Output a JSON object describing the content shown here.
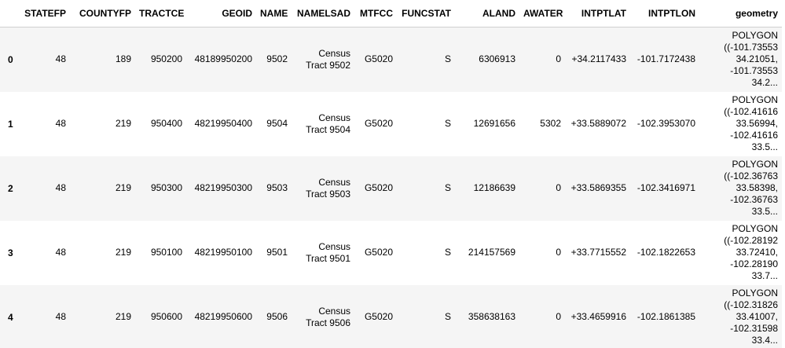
{
  "table": {
    "index_header": "",
    "columns": [
      "STATEFP",
      "COUNTYFP",
      "TRACTCE",
      "GEOID",
      "NAME",
      "NAMELSAD",
      "MTFCC",
      "FUNCSTAT",
      "ALAND",
      "AWATER",
      "INTPTLAT",
      "INTPTLON",
      "geometry"
    ],
    "rows": [
      {
        "index": "0",
        "cells": [
          "48",
          "189",
          "950200",
          "48189950200",
          "9502",
          "Census Tract 9502",
          "G5020",
          "S",
          "6306913",
          "0",
          "+34.2117433",
          "-101.7172438",
          "POLYGON ((-101.73553 34.21051, -101.73553 34.2..."
        ]
      },
      {
        "index": "1",
        "cells": [
          "48",
          "219",
          "950400",
          "48219950400",
          "9504",
          "Census Tract 9504",
          "G5020",
          "S",
          "12691656",
          "5302",
          "+33.5889072",
          "-102.3953070",
          "POLYGON ((-102.41616 33.56994, -102.41616 33.5..."
        ]
      },
      {
        "index": "2",
        "cells": [
          "48",
          "219",
          "950300",
          "48219950300",
          "9503",
          "Census Tract 9503",
          "G5020",
          "S",
          "12186639",
          "0",
          "+33.5869355",
          "-102.3416971",
          "POLYGON ((-102.36763 33.58398, -102.36763 33.5..."
        ]
      },
      {
        "index": "3",
        "cells": [
          "48",
          "219",
          "950100",
          "48219950100",
          "9501",
          "Census Tract 9501",
          "G5020",
          "S",
          "214157569",
          "0",
          "+33.7715552",
          "-102.1822653",
          "POLYGON ((-102.28192 33.72410, -102.28190 33.7..."
        ]
      },
      {
        "index": "4",
        "cells": [
          "48",
          "219",
          "950600",
          "48219950600",
          "9506",
          "Census Tract 9506",
          "G5020",
          "S",
          "358638163",
          "0",
          "+33.4659916",
          "-102.1861385",
          "POLYGON ((-102.31826 33.41007, -102.31598 33.4..."
        ]
      }
    ]
  }
}
